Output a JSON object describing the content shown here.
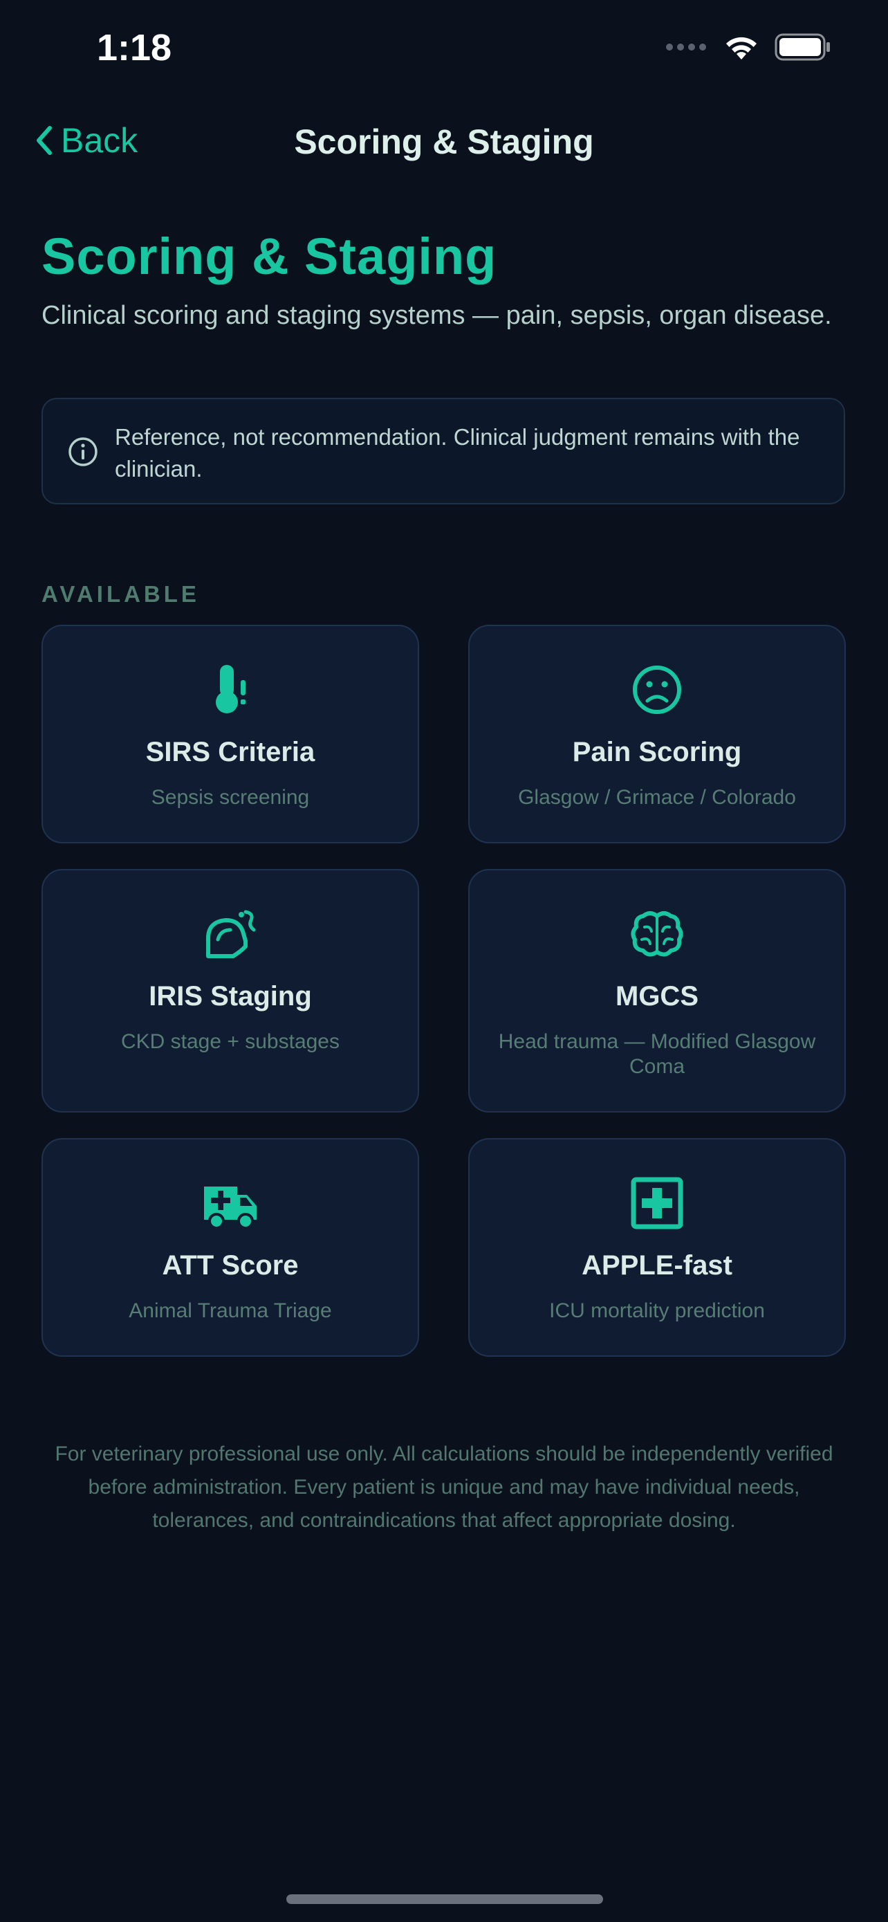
{
  "status_bar": {
    "time": "1:18",
    "icons": [
      "signal-icon",
      "wifi-icon",
      "battery-icon"
    ]
  },
  "nav": {
    "back_label": "Back",
    "title": "Scoring & Staging"
  },
  "header": {
    "title": "Scoring & Staging",
    "subtitle": "Clinical scoring and staging systems — pain, sepsis, organ disease."
  },
  "notice": {
    "icon": "info-icon",
    "text": "Reference, not recommendation. Clinical judgment remains with the clinician."
  },
  "section": {
    "label": "AVAILABLE"
  },
  "cards": [
    {
      "icon": "thermometer-alert-icon",
      "title": "SIRS Criteria",
      "subtitle": "Sepsis screening"
    },
    {
      "icon": "frown-face-icon",
      "title": "Pain Scoring",
      "subtitle": "Glasgow / Grimace / Colorado"
    },
    {
      "icon": "kidney-icon",
      "title": "IRIS Staging",
      "subtitle": "CKD stage + substages"
    },
    {
      "icon": "brain-icon",
      "title": "MGCS",
      "subtitle": "Head trauma — Modified Glasgow Coma"
    },
    {
      "icon": "ambulance-icon",
      "title": "ATT Score",
      "subtitle": "Animal Trauma Triage"
    },
    {
      "icon": "medical-square-icon",
      "title": "APPLE-fast",
      "subtitle": "ICU mortality prediction"
    }
  ],
  "footer": {
    "disclaimer": "For veterinary professional use only. All calculations should be independently verified before administration. Every patient is unique and may have individual needs, tolerances, and contraindications that affect appropriate dosing."
  },
  "colors": {
    "background": "#0a101c",
    "accent": "#19c6a2",
    "card_bg": "#0f1c31",
    "card_border": "#1f3350",
    "muted_text": "#577d75"
  }
}
